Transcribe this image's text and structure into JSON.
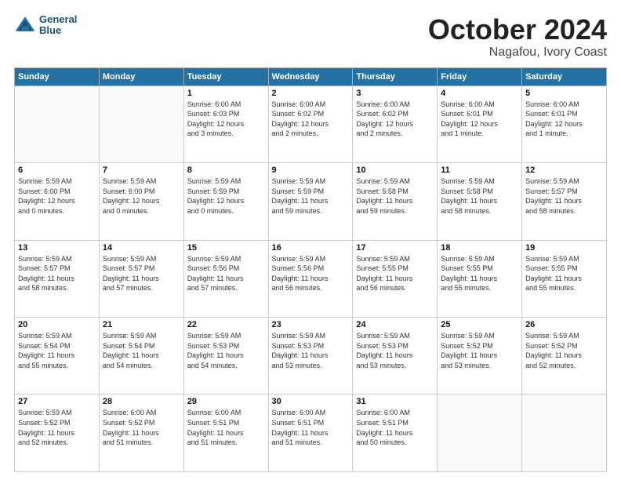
{
  "header": {
    "logo_line1": "General",
    "logo_line2": "Blue",
    "title": "October 2024",
    "location": "Nagafou, Ivory Coast"
  },
  "weekdays": [
    "Sunday",
    "Monday",
    "Tuesday",
    "Wednesday",
    "Thursday",
    "Friday",
    "Saturday"
  ],
  "weeks": [
    [
      {
        "num": "",
        "info": ""
      },
      {
        "num": "",
        "info": ""
      },
      {
        "num": "1",
        "info": "Sunrise: 6:00 AM\nSunset: 6:03 PM\nDaylight: 12 hours\nand 3 minutes."
      },
      {
        "num": "2",
        "info": "Sunrise: 6:00 AM\nSunset: 6:02 PM\nDaylight: 12 hours\nand 2 minutes."
      },
      {
        "num": "3",
        "info": "Sunrise: 6:00 AM\nSunset: 6:02 PM\nDaylight: 12 hours\nand 2 minutes."
      },
      {
        "num": "4",
        "info": "Sunrise: 6:00 AM\nSunset: 6:01 PM\nDaylight: 12 hours\nand 1 minute."
      },
      {
        "num": "5",
        "info": "Sunrise: 6:00 AM\nSunset: 6:01 PM\nDaylight: 12 hours\nand 1 minute."
      }
    ],
    [
      {
        "num": "6",
        "info": "Sunrise: 5:59 AM\nSunset: 6:00 PM\nDaylight: 12 hours\nand 0 minutes."
      },
      {
        "num": "7",
        "info": "Sunrise: 5:59 AM\nSunset: 6:00 PM\nDaylight: 12 hours\nand 0 minutes."
      },
      {
        "num": "8",
        "info": "Sunrise: 5:59 AM\nSunset: 5:59 PM\nDaylight: 12 hours\nand 0 minutes."
      },
      {
        "num": "9",
        "info": "Sunrise: 5:59 AM\nSunset: 5:59 PM\nDaylight: 11 hours\nand 59 minutes."
      },
      {
        "num": "10",
        "info": "Sunrise: 5:59 AM\nSunset: 5:58 PM\nDaylight: 11 hours\nand 59 minutes."
      },
      {
        "num": "11",
        "info": "Sunrise: 5:59 AM\nSunset: 5:58 PM\nDaylight: 11 hours\nand 58 minutes."
      },
      {
        "num": "12",
        "info": "Sunrise: 5:59 AM\nSunset: 5:57 PM\nDaylight: 11 hours\nand 58 minutes."
      }
    ],
    [
      {
        "num": "13",
        "info": "Sunrise: 5:59 AM\nSunset: 5:57 PM\nDaylight: 11 hours\nand 58 minutes."
      },
      {
        "num": "14",
        "info": "Sunrise: 5:59 AM\nSunset: 5:57 PM\nDaylight: 11 hours\nand 57 minutes."
      },
      {
        "num": "15",
        "info": "Sunrise: 5:59 AM\nSunset: 5:56 PM\nDaylight: 11 hours\nand 57 minutes."
      },
      {
        "num": "16",
        "info": "Sunrise: 5:59 AM\nSunset: 5:56 PM\nDaylight: 11 hours\nand 56 minutes."
      },
      {
        "num": "17",
        "info": "Sunrise: 5:59 AM\nSunset: 5:55 PM\nDaylight: 11 hours\nand 56 minutes."
      },
      {
        "num": "18",
        "info": "Sunrise: 5:59 AM\nSunset: 5:55 PM\nDaylight: 11 hours\nand 55 minutes."
      },
      {
        "num": "19",
        "info": "Sunrise: 5:59 AM\nSunset: 5:55 PM\nDaylight: 11 hours\nand 55 minutes."
      }
    ],
    [
      {
        "num": "20",
        "info": "Sunrise: 5:59 AM\nSunset: 5:54 PM\nDaylight: 11 hours\nand 55 minutes."
      },
      {
        "num": "21",
        "info": "Sunrise: 5:59 AM\nSunset: 5:54 PM\nDaylight: 11 hours\nand 54 minutes."
      },
      {
        "num": "22",
        "info": "Sunrise: 5:59 AM\nSunset: 5:53 PM\nDaylight: 11 hours\nand 54 minutes."
      },
      {
        "num": "23",
        "info": "Sunrise: 5:59 AM\nSunset: 5:53 PM\nDaylight: 11 hours\nand 53 minutes."
      },
      {
        "num": "24",
        "info": "Sunrise: 5:59 AM\nSunset: 5:53 PM\nDaylight: 11 hours\nand 53 minutes."
      },
      {
        "num": "25",
        "info": "Sunrise: 5:59 AM\nSunset: 5:52 PM\nDaylight: 11 hours\nand 53 minutes."
      },
      {
        "num": "26",
        "info": "Sunrise: 5:59 AM\nSunset: 5:52 PM\nDaylight: 11 hours\nand 52 minutes."
      }
    ],
    [
      {
        "num": "27",
        "info": "Sunrise: 5:59 AM\nSunset: 5:52 PM\nDaylight: 11 hours\nand 52 minutes."
      },
      {
        "num": "28",
        "info": "Sunrise: 6:00 AM\nSunset: 5:52 PM\nDaylight: 11 hours\nand 51 minutes."
      },
      {
        "num": "29",
        "info": "Sunrise: 6:00 AM\nSunset: 5:51 PM\nDaylight: 11 hours\nand 51 minutes."
      },
      {
        "num": "30",
        "info": "Sunrise: 6:00 AM\nSunset: 5:51 PM\nDaylight: 11 hours\nand 51 minutes."
      },
      {
        "num": "31",
        "info": "Sunrise: 6:00 AM\nSunset: 5:51 PM\nDaylight: 11 hours\nand 50 minutes."
      },
      {
        "num": "",
        "info": ""
      },
      {
        "num": "",
        "info": ""
      }
    ]
  ]
}
